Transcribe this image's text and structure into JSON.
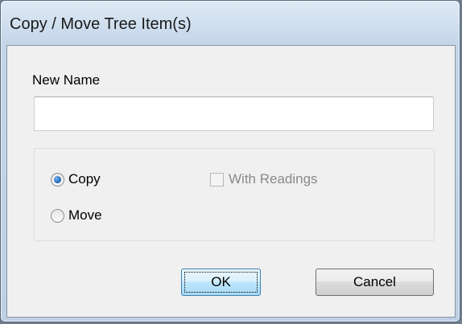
{
  "dialog": {
    "title": "Copy / Move Tree Item(s)"
  },
  "form": {
    "new_name_label": "New Name",
    "new_name_value": "",
    "new_name_placeholder": ""
  },
  "operation": {
    "options": [
      {
        "label": "Copy",
        "checked": true
      },
      {
        "label": "Move",
        "checked": false
      }
    ],
    "with_readings": {
      "label": "With Readings",
      "checked": false,
      "enabled": false
    }
  },
  "buttons": {
    "ok_label": "OK",
    "cancel_label": "Cancel"
  },
  "colors": {
    "accent": "#3c7fb1",
    "disabled_text": "#8a8a8a"
  }
}
